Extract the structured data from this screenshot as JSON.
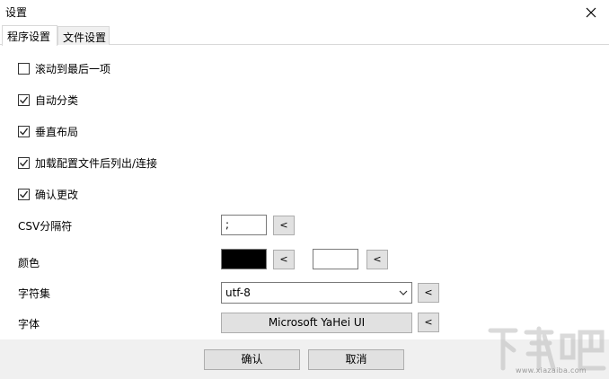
{
  "window": {
    "title": "设置"
  },
  "tabs": [
    {
      "label": "程序设置",
      "active": true
    },
    {
      "label": "文件设置",
      "active": false
    }
  ],
  "options": [
    {
      "label": "滚动到最后一项",
      "checked": false
    },
    {
      "label": "自动分类",
      "checked": true
    },
    {
      "label": "垂直布局",
      "checked": true
    },
    {
      "label": "加载配置文件后列出/连接",
      "checked": true
    },
    {
      "label": "确认更改",
      "checked": true
    }
  ],
  "csv": {
    "label": "CSV分隔符",
    "value": ";",
    "reset_label": "<"
  },
  "color": {
    "label": "颜色",
    "foreground": "#000000",
    "background": "#ffffff",
    "reset_label": "<"
  },
  "charset": {
    "label": "字符集",
    "value": "utf-8",
    "reset_label": "<"
  },
  "font": {
    "label": "字体",
    "value": "Microsoft YaHei UI",
    "reset_label": "<"
  },
  "buttons": {
    "ok": "确认",
    "cancel": "取消"
  },
  "watermark": {
    "logo": "下载吧",
    "url": "www.xiazaiba.com"
  }
}
